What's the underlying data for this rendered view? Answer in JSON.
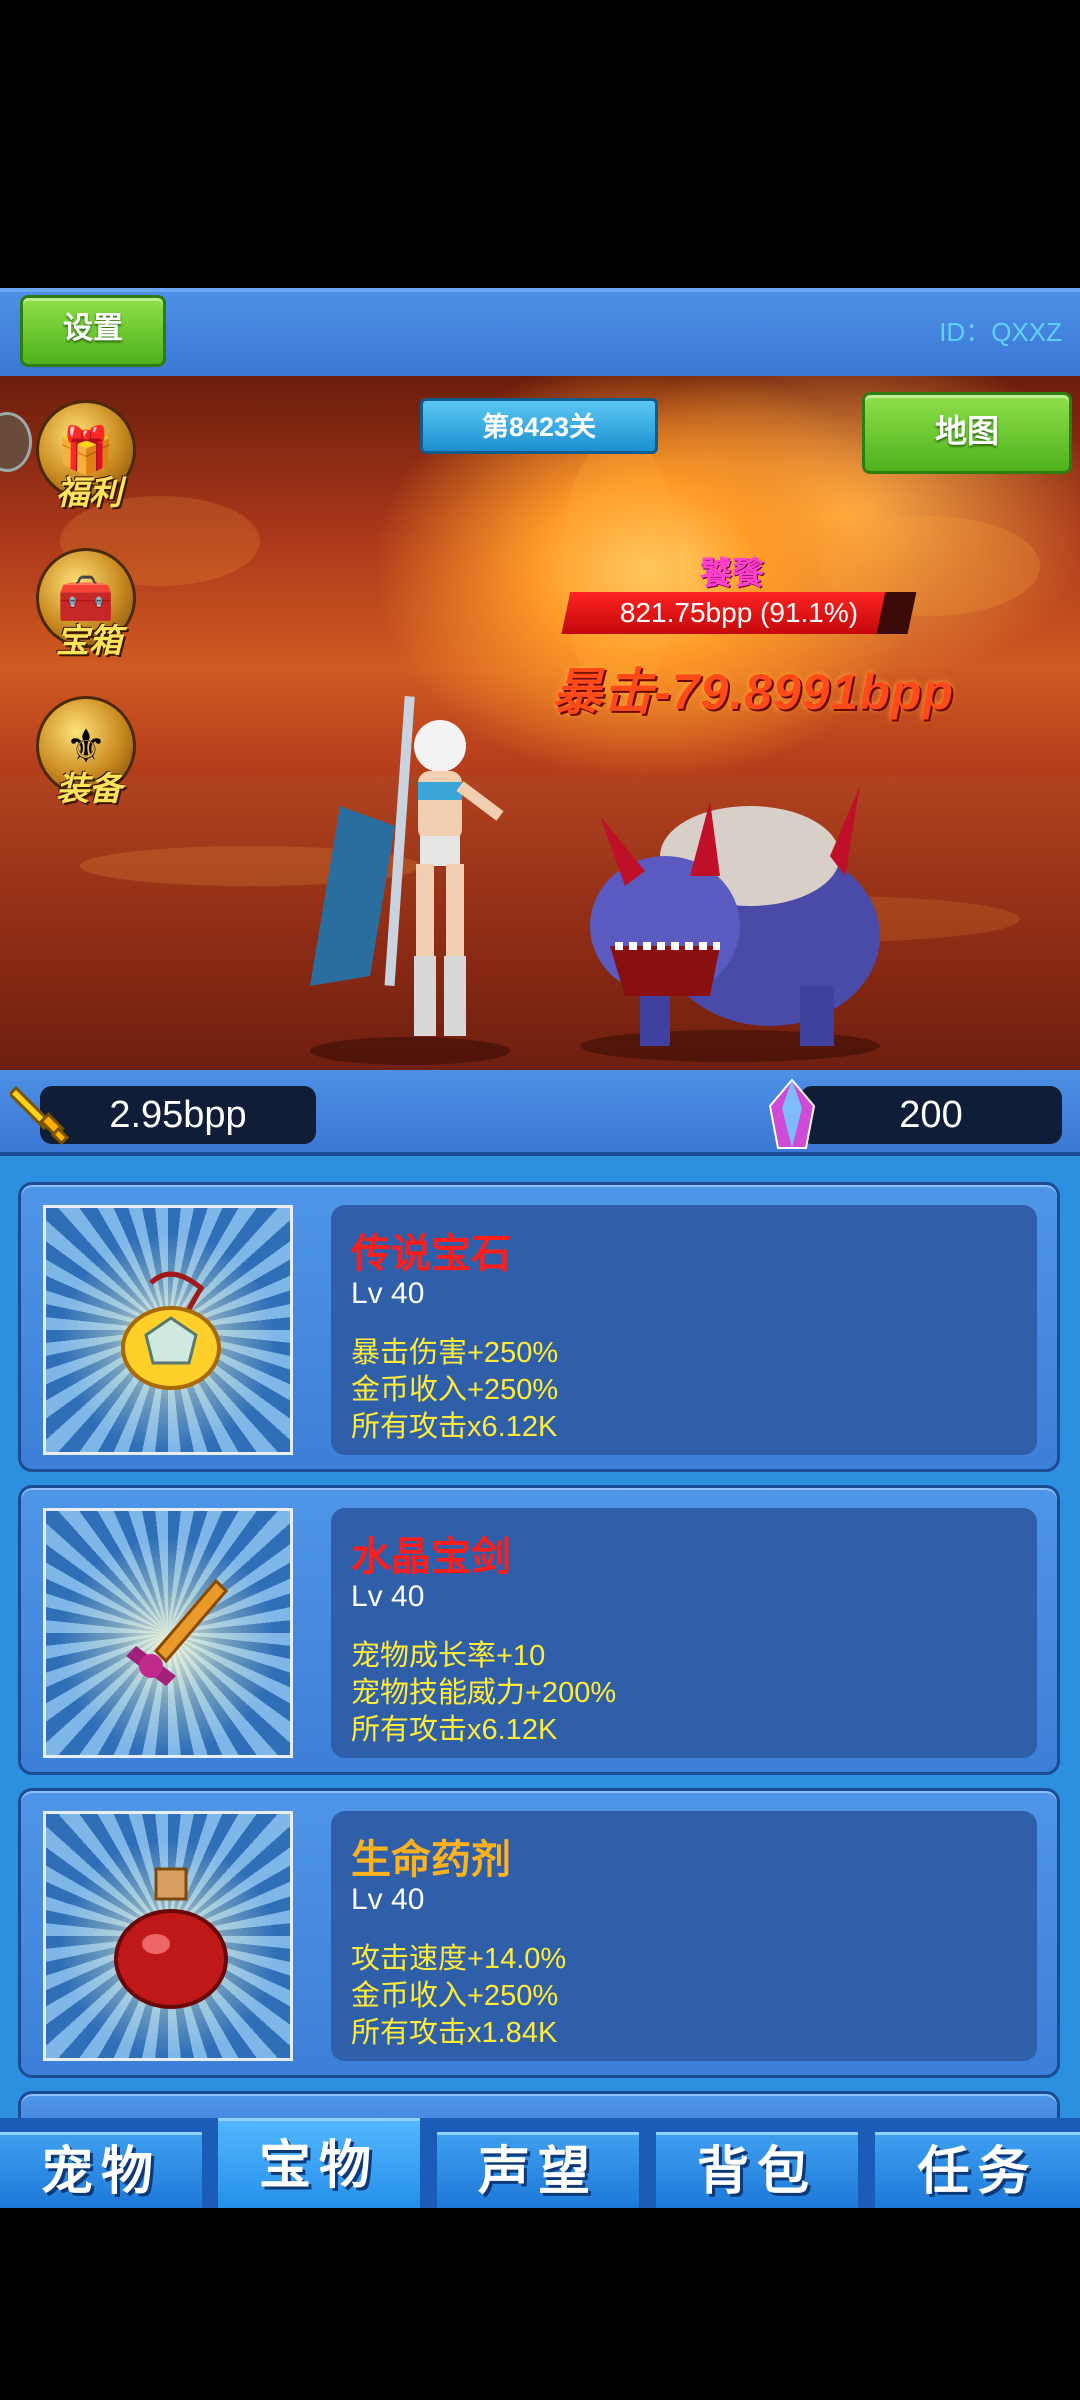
{
  "header": {
    "settings_label": "设置",
    "user_id": "ID：QXXZ"
  },
  "battle": {
    "stage_label": "第8423关",
    "map_label": "地图",
    "side_menu": [
      {
        "label": "福利",
        "icon": "gift-icon"
      },
      {
        "label": "宝箱",
        "icon": "treasure-chest-icon"
      },
      {
        "label": "装备",
        "icon": "helmet-icon"
      }
    ],
    "enemy_name": "饕餮",
    "enemy_hp_text": "821.75bpp (91.1%)",
    "enemy_hp_fraction": 0.911,
    "crit_text": "暴击-79.8991bpp"
  },
  "currency": {
    "power": "2.95bpp",
    "gems": "200"
  },
  "items": [
    {
      "name": "传说宝石",
      "name_color": "#ff1e1e",
      "level": "Lv 40",
      "stats": [
        "暴击伤害+250%",
        "金币收入+250%",
        "所有攻击x6.12K"
      ],
      "icon": "gem-amulet-icon"
    },
    {
      "name": "水晶宝剑",
      "name_color": "#ff1e1e",
      "level": "Lv 40",
      "stats": [
        "宠物成长率+10",
        "宠物技能威力+200%",
        "所有攻击x6.12K"
      ],
      "icon": "crystal-sword-icon"
    },
    {
      "name": "生命药剂",
      "name_color": "#ffb21e",
      "level": "Lv 40",
      "stats": [
        "攻击速度+14.0%",
        "金币收入+250%",
        "所有攻击x1.84K"
      ],
      "icon": "health-potion-icon"
    }
  ],
  "tabs": [
    {
      "label": "宠物"
    },
    {
      "label": "宝物",
      "active": true
    },
    {
      "label": "声望"
    },
    {
      "label": "背包"
    },
    {
      "label": "任务"
    }
  ]
}
